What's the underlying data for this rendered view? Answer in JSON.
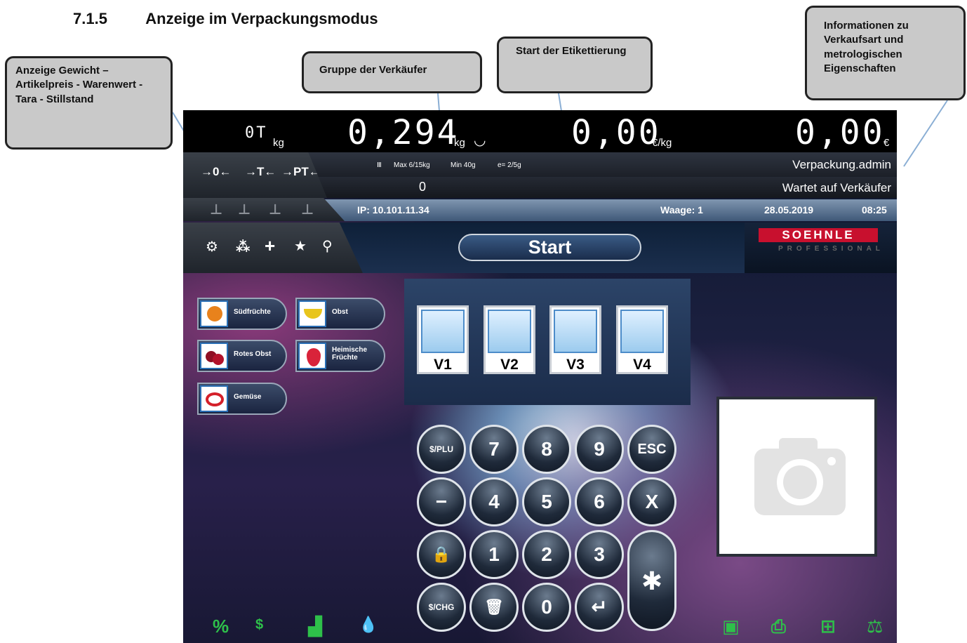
{
  "heading": {
    "number": "7.1.5",
    "title": "Anzeige im Verpackungsmodus"
  },
  "callouts": {
    "weight": "Anzeige Gewicht – Artikelpreis - Warenwert - Tara - Stillstand",
    "group": "Gruppe der Verkäufer",
    "labeling": "Start der Etikettierung",
    "info": "Informationen zu Verkaufsart und metrologischen Eigenschaften"
  },
  "display": {
    "tare": {
      "value": "0T",
      "unit": "kg"
    },
    "weight": {
      "value": "0,294",
      "unit": "kg"
    },
    "price": {
      "value": "0,00",
      "unit": "€/kg"
    },
    "total": {
      "value": "0,00",
      "unit": "€"
    }
  },
  "metrology": {
    "class": "Ⅲ",
    "max": "Max 6/15kg",
    "min": "Min 40g",
    "e": "e= 2/5g"
  },
  "status": {
    "mode": "Verpackung.admin",
    "count": "0",
    "state": "Wartet auf Verkäufer",
    "ip": "IP: 10.101.11.34",
    "scale": "Waage: 1",
    "date": "28.05.2019",
    "time": "08:25"
  },
  "tare_icons": [
    "→0←",
    "→T←",
    "→PT←"
  ],
  "toolbar_icons": [
    "gear-icon",
    "share-icon",
    "plus-icon",
    "star-icon",
    "search-icon"
  ],
  "start_label": "Start",
  "brand": {
    "name": "SOEHNLE",
    "sub": "PROFESSIONAL"
  },
  "categories": [
    {
      "label": "Südfrüchte",
      "color": "#e8821c"
    },
    {
      "label": "Obst",
      "color": "#e8c51c"
    },
    {
      "label": "Rotes Obst",
      "color": "#b3122b"
    },
    {
      "label": "Heimische Früchte",
      "color": "#d9233a"
    },
    {
      "label": "Gemüse",
      "color": "#d4202a"
    }
  ],
  "vendors": [
    "V1",
    "V2",
    "V3",
    "V4"
  ],
  "keypad": {
    "row1": [
      "$/PLU",
      "7",
      "8",
      "9",
      "ESC"
    ],
    "row2": [
      "−",
      "4",
      "5",
      "6",
      "X"
    ],
    "row3": [
      "🔒",
      "1",
      "2",
      "3"
    ],
    "row4": [
      "$/CHG",
      "🗑",
      "0",
      "↵"
    ],
    "star": "✱"
  },
  "bottom_icons_left": [
    "%",
    "$",
    "▟",
    "💧"
  ],
  "bottom_icons_right": [
    "calculator-icon",
    "printer-icon",
    "network-icon",
    "scale-icon"
  ]
}
